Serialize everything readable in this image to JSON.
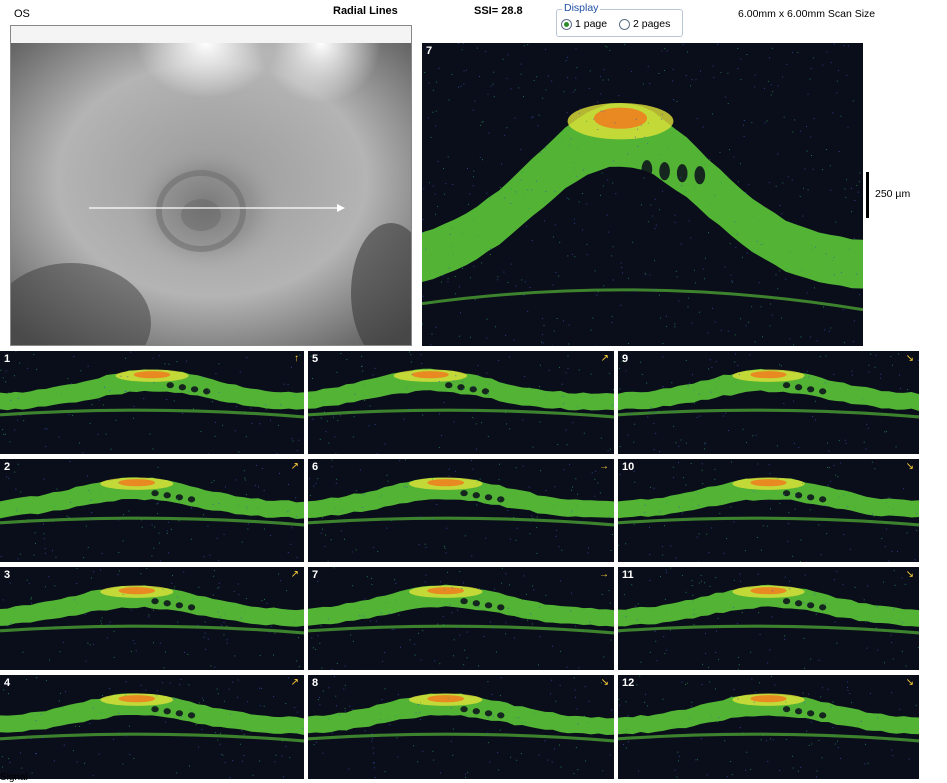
{
  "header": {
    "eye": "OS",
    "mode": "Radial Lines",
    "ssi": "SSI= 28.8",
    "scan_size": "6.00mm x 6.00mm Scan Size"
  },
  "display": {
    "legend": "Display",
    "options": [
      "1 page",
      "2 pages"
    ],
    "selected": "1 page"
  },
  "main_scan": {
    "number": "7"
  },
  "scale": {
    "label": "250 µm"
  },
  "thumbnails": [
    {
      "number": "1",
      "arrow": "↑"
    },
    {
      "number": "2",
      "arrow": "↗"
    },
    {
      "number": "3",
      "arrow": "↗"
    },
    {
      "number": "4",
      "arrow": "↗"
    },
    {
      "number": "5",
      "arrow": "↗"
    },
    {
      "number": "6",
      "arrow": "→"
    },
    {
      "number": "7",
      "arrow": "→"
    },
    {
      "number": "8",
      "arrow": "↘"
    },
    {
      "number": "9",
      "arrow": "↘"
    },
    {
      "number": "10",
      "arrow": "↘"
    },
    {
      "number": "11",
      "arrow": "↘"
    },
    {
      "number": "12",
      "arrow": "↘"
    }
  ],
  "footer": {
    "note": "Signal"
  },
  "colors": {
    "scan_bg": "#0a0d1a",
    "retina_green": "#5fd13b",
    "retina_yellow": "#e0e23a",
    "retina_orange": "#f07a1e",
    "radio_selected": "#2a8c2a",
    "legend_blue": "#1f4fa3",
    "arrow_yellow": "#ffd23a"
  }
}
